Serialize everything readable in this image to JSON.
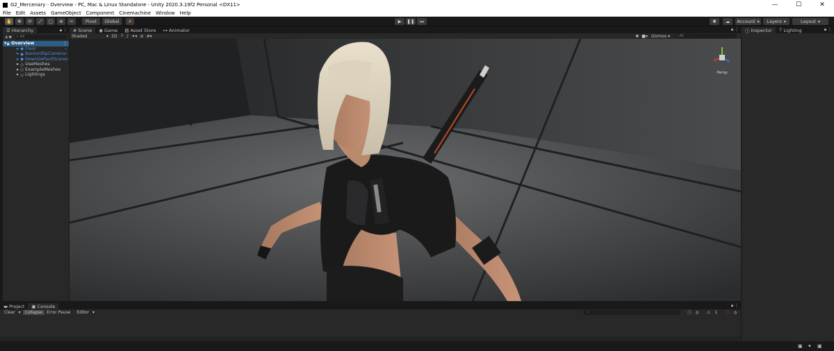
{
  "window": {
    "title": "G2_Mercenary - Overview - PC, Mac & Linux Standalone - Unity 2020.3.19f2 Personal <DX11>",
    "minimize": "—",
    "maximize": "☐",
    "close": "✕"
  },
  "menu": [
    "File",
    "Edit",
    "Assets",
    "GameObject",
    "Component",
    "Cinemachine",
    "Window",
    "Help"
  ],
  "toolbar": {
    "pivot": "Pivot",
    "global": "Global",
    "account": "Account",
    "layers": "Layers",
    "layout": "Layout"
  },
  "hierarchy": {
    "tab": "Hierarchy",
    "search_placeholder": "All",
    "items": [
      {
        "label": "Overview",
        "selected": true
      },
      {
        "label": "Floor",
        "blue": true
      },
      {
        "label": "BaroordSpCamera",
        "blue": true
      },
      {
        "label": "DownDefaultScene",
        "blue": true
      },
      {
        "label": "UseMeshes"
      },
      {
        "label": "ExampleMeshes"
      },
      {
        "label": "Lightings"
      }
    ]
  },
  "scene": {
    "tabs": [
      "Scene",
      "Game",
      "Asset Store",
      "Animator"
    ],
    "shading": "Shaded",
    "mode2d": "2D",
    "gizmos": "Gizmos",
    "search_placeholder": "All",
    "persp": "Persp"
  },
  "right": {
    "inspector": "Inspector",
    "lighting": "Lighting"
  },
  "bottom": {
    "tabs": [
      "Project",
      "Console"
    ],
    "clear": "Clear",
    "collapse": "Collapse",
    "error_pause": "Error Pause",
    "editor": "Editor",
    "count_info": "0",
    "count_warn": "1",
    "count_err": "0"
  },
  "colors": {
    "accent": "#2c5d87",
    "prefab_blue": "#4c8fe0",
    "panel": "#282828",
    "chrome": "#191919"
  }
}
